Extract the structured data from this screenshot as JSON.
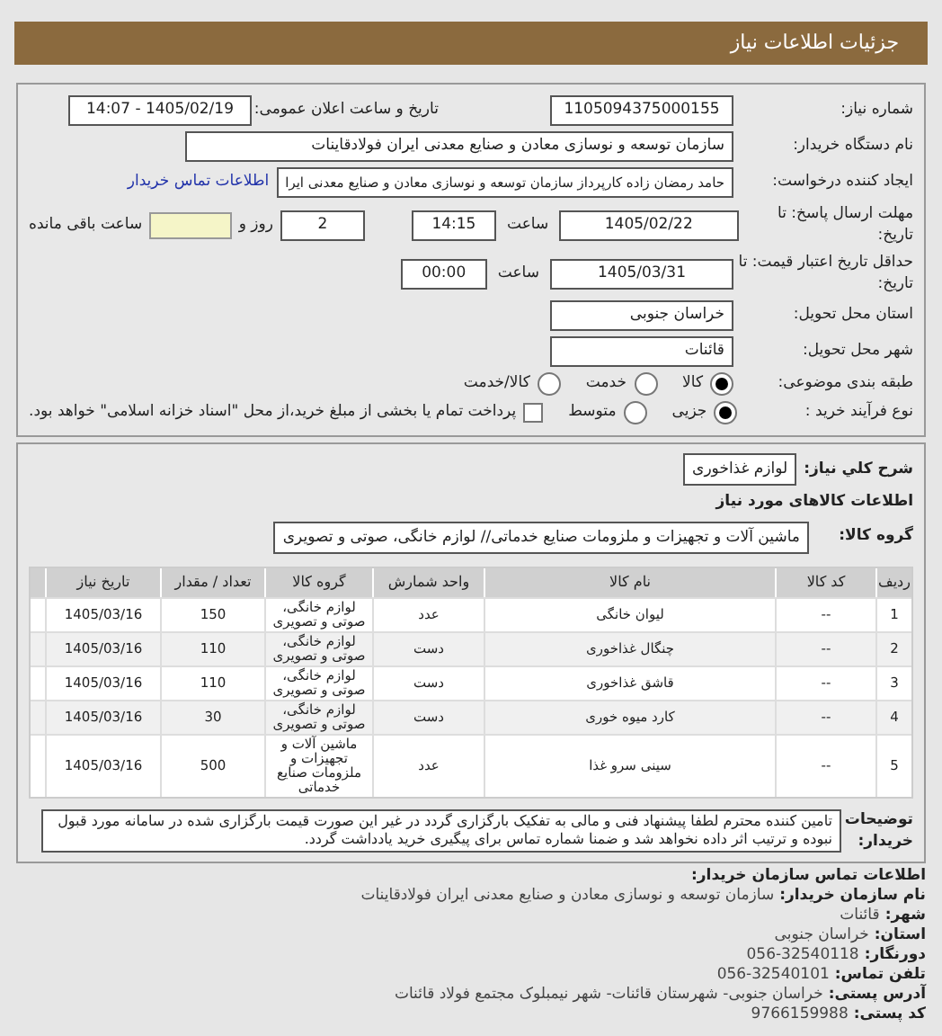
{
  "header": {
    "title": "جزئیات اطلاعات نیاز"
  },
  "need": {
    "number_label": "شماره نیاز:",
    "number": "1105094375000155",
    "announce_label": "تاریخ و ساعت اعلان عمومی:",
    "announce": "1405/02/19 - 14:07",
    "buyer_label": "نام دستگاه خریدار:",
    "buyer": "سازمان توسعه و نوسازی معادن و صنایع معدنی ایران فولادقاینات",
    "creator_label": "ایجاد کننده درخواست:",
    "creator": "حامد  رمضان زاده  کارپرداز  سازمان توسعه و نوسازی معادن و صنایع معدنی ایرا",
    "contact_link": "اطلاعات تماس خریدار",
    "deadline_label": "مهلت ارسال پاسخ: تا تاریخ:",
    "deadline_date": "1405/02/22",
    "time_label": "ساعت",
    "deadline_time": "14:15",
    "days": "2",
    "days_label": "روز و",
    "remaining_label": "ساعت باقی مانده",
    "validity_label": "حداقل تاریخ اعتبار قیمت: تا تاریخ:",
    "validity_date": "1405/03/31",
    "validity_time_label": "ساعت",
    "validity_time": "00:00",
    "province_label": "استان محل تحویل:",
    "province": "خراسان جنوبی",
    "city_label": "شهر محل تحویل:",
    "city": "قائنات",
    "category_label": "طبقه بندی موضوعی:",
    "categories": [
      {
        "label": "کالا",
        "selected": true
      },
      {
        "label": "خدمت",
        "selected": false
      },
      {
        "label": "کالا/خدمت",
        "selected": false
      }
    ],
    "process_label": "نوع فرآیند خرید :",
    "processes": [
      {
        "label": "جزیی",
        "selected": true
      },
      {
        "label": "متوسط",
        "selected": false
      }
    ],
    "treasury": {
      "checked": false,
      "label": "پرداخت تمام یا بخشی از مبلغ خرید،از محل \"اسناد خزانه اسلامی\" خواهد بود."
    }
  },
  "goods": {
    "summary_label": "شرح کلي نياز:",
    "summary": "لوازم غذاخوری",
    "heading": "اطلاعات کالاهای مورد نیاز",
    "group_label": "گروه کالا:",
    "group": "ماشین آلات و تجهیزات و ملزومات صنایع خدماتی// لوازم خانگی، صوتی و تصویری",
    "columns": [
      "ردیف",
      "کد کالا",
      "نام کالا",
      "واحد شمارش",
      "گروه کالا",
      "تعداد / مقدار",
      "تاریخ نیاز"
    ],
    "rows": [
      [
        "1",
        "--",
        "لیوان خانگی",
        "عدد",
        "لوازم خانگی، صوتی و تصویری",
        "150",
        "1405/03/16"
      ],
      [
        "2",
        "--",
        "چنگال غذاخوری",
        "دست",
        "لوازم خانگی، صوتی و تصویری",
        "110",
        "1405/03/16"
      ],
      [
        "3",
        "--",
        "قاشق غذاخوری",
        "دست",
        "لوازم خانگی، صوتی و تصویری",
        "110",
        "1405/03/16"
      ],
      [
        "4",
        "--",
        "کارد میوه خوری",
        "دست",
        "لوازم خانگی، صوتی و تصویری",
        "30",
        "1405/03/16"
      ],
      [
        "5",
        "--",
        "سینی سرو غذا",
        "عدد",
        "ماشین آلات و تجهیزات و ملزومات صنایع خدماتی",
        "500",
        "1405/03/16"
      ]
    ],
    "notes_label": "توضیحات خریدار:",
    "notes": "تامین کننده محترم لطفا پیشنهاد فنی و مالی به تفکیک بارگزاری گردد در غیر این صورت قیمت بارگزاری شده در سامانه مورد قبول نبوده و ترتیب اثر داده نخواهد شد و ضمنا شماره تماس برای پیگیری خرید یادداشت گردد."
  },
  "contact": {
    "heading": "اطلاعات تماس سازمان خریدار:",
    "lines": [
      {
        "label": "نام سازمان خریدار:",
        "value": "سازمان توسعه و نوسازی معادن و صنایع معدنی ایران فولادقاینات"
      },
      {
        "label": "شهر:",
        "value": "قائنات"
      },
      {
        "label": "استان:",
        "value": "خراسان جنوبی"
      },
      {
        "label": "دورنگار:",
        "value": "056-32540118"
      },
      {
        "label": "تلفن تماس:",
        "value": "056-32540101"
      },
      {
        "label": "آدرس پستی:",
        "value": "خراسان جنوبی- شهرستان قائنات- شهر نیمبلوک مجتمع فولاد قائنات"
      },
      {
        "label": "کد پستی:",
        "value": "9766159988"
      }
    ]
  }
}
